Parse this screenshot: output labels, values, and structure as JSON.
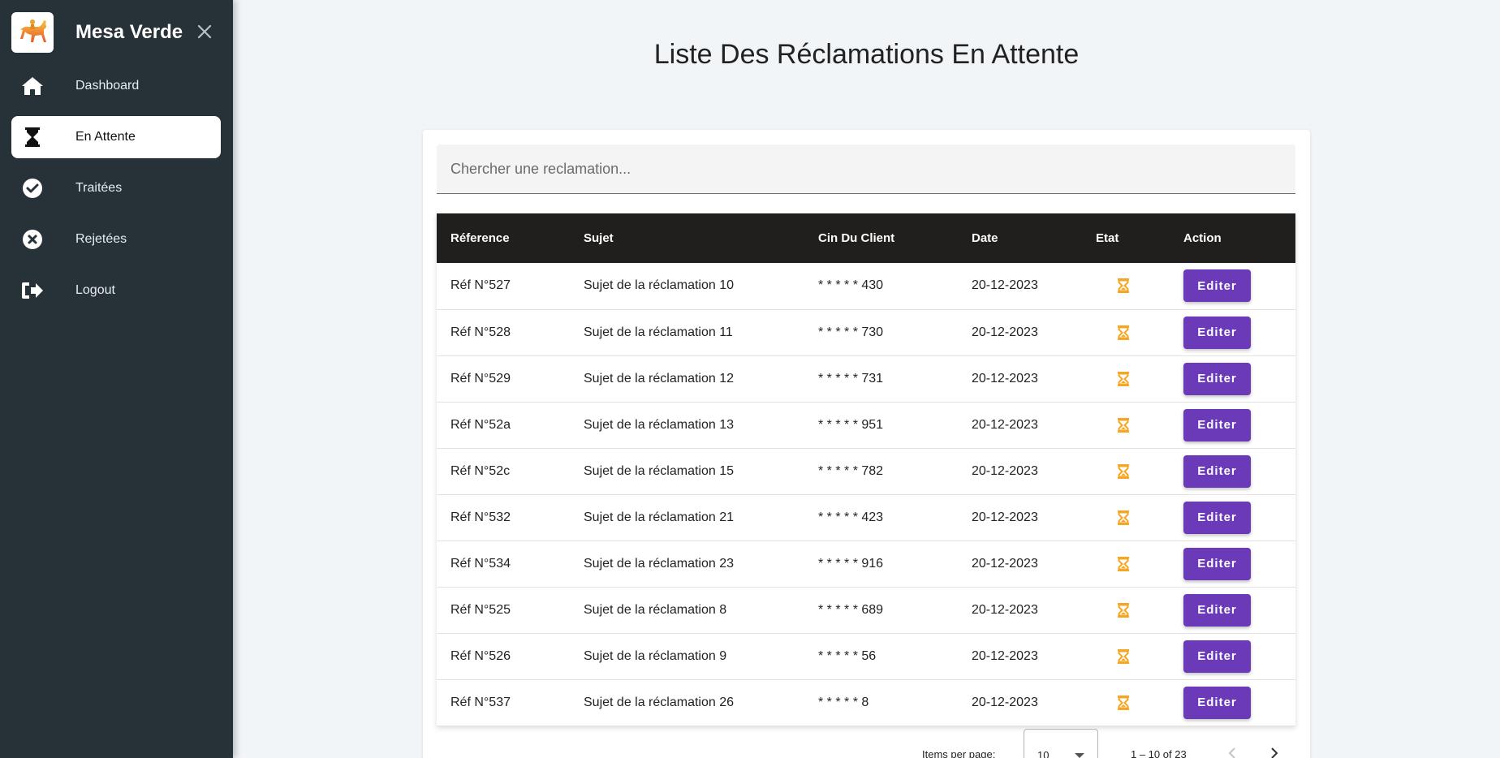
{
  "sidebar": {
    "brand": "Mesa Verde",
    "items": [
      {
        "label": "Dashboard",
        "icon": "home-icon"
      },
      {
        "label": "En Attente",
        "icon": "hourglass-icon"
      },
      {
        "label": "Traitées",
        "icon": "check-circle-icon"
      },
      {
        "label": "Rejetées",
        "icon": "x-circle-icon"
      },
      {
        "label": "Logout",
        "icon": "logout-icon"
      }
    ],
    "active_index": 1
  },
  "main": {
    "title": "Liste Des Réclamations En Attente",
    "search_placeholder": "Chercher une reclamation..."
  },
  "table": {
    "headers": [
      "Réference",
      "Sujet",
      "Cin Du Client",
      "Date",
      "Etat",
      "Action"
    ],
    "rows": [
      {
        "ref": "Réf N°527",
        "sujet": "Sujet de la réclamation 10",
        "cin": "* * * * * 430",
        "date": "20-12-2023",
        "action": "Editer"
      },
      {
        "ref": "Réf N°528",
        "sujet": "Sujet de la réclamation 11",
        "cin": "* * * * * 730",
        "date": "20-12-2023",
        "action": "Editer"
      },
      {
        "ref": "Réf N°529",
        "sujet": "Sujet de la réclamation 12",
        "cin": "* * * * * 731",
        "date": "20-12-2023",
        "action": "Editer"
      },
      {
        "ref": "Réf N°52a",
        "sujet": "Sujet de la réclamation 13",
        "cin": "* * * * * 951",
        "date": "20-12-2023",
        "action": "Editer"
      },
      {
        "ref": "Réf N°52c",
        "sujet": "Sujet de la réclamation 15",
        "cin": "* * * * * 782",
        "date": "20-12-2023",
        "action": "Editer"
      },
      {
        "ref": "Réf N°532",
        "sujet": "Sujet de la réclamation 21",
        "cin": "* * * * * 423",
        "date": "20-12-2023",
        "action": "Editer"
      },
      {
        "ref": "Réf N°534",
        "sujet": "Sujet de la réclamation 23",
        "cin": "* * * * * 916",
        "date": "20-12-2023",
        "action": "Editer"
      },
      {
        "ref": "Réf N°525",
        "sujet": "Sujet de la réclamation 8",
        "cin": "* * * * * 689",
        "date": "20-12-2023",
        "action": "Editer"
      },
      {
        "ref": "Réf N°526",
        "sujet": "Sujet de la réclamation 9",
        "cin": "* * * * * 56",
        "date": "20-12-2023",
        "action": "Editer"
      },
      {
        "ref": "Réf N°537",
        "sujet": "Sujet de la réclamation 26",
        "cin": "* * * * * 8",
        "date": "20-12-2023",
        "action": "Editer"
      }
    ]
  },
  "paginator": {
    "items_per_page_label": "Items per page:",
    "items_per_page_value": "10",
    "range_label": "1 – 10 of 23"
  },
  "colors": {
    "sidebar_bg": "#263238",
    "header_bg": "#211f1e",
    "button_bg": "#6a3ab8",
    "pending_icon": "#f5a623"
  }
}
